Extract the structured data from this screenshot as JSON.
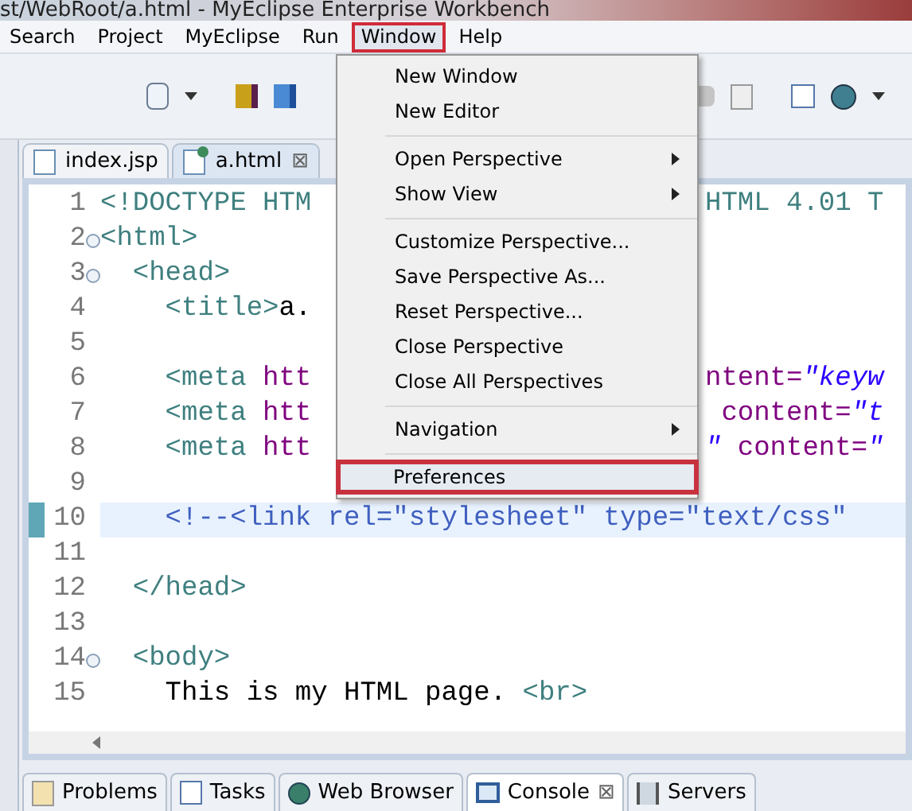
{
  "window": {
    "title": "st/WebRoot/a.html - MyEclipse Enterprise Workbench"
  },
  "menu_bar": [
    {
      "label": "Search",
      "selected": false
    },
    {
      "label": "Project",
      "selected": false
    },
    {
      "label": "MyEclipse",
      "selected": false
    },
    {
      "label": "Run",
      "selected": false
    },
    {
      "label": "Window",
      "selected": true
    },
    {
      "label": "Help",
      "selected": false
    }
  ],
  "editor_tabs": [
    {
      "label": "index.jsp",
      "kind": "jsp",
      "selected": false
    },
    {
      "label": "a.html",
      "kind": "html",
      "selected": true,
      "close": "⊠"
    }
  ],
  "editor": {
    "lines": [
      {
        "number": "1",
        "fold": false,
        "current": false,
        "left": [
          {
            "kind": "tag",
            "text": "<!DOCTYPE HTM"
          }
        ],
        "right": [
          {
            "kind": "tag",
            "text": "HTML 4.01 T"
          }
        ]
      },
      {
        "number": "2",
        "fold": true,
        "current": false,
        "left": [
          {
            "kind": "tag",
            "text": "<html>"
          }
        ]
      },
      {
        "number": "3",
        "fold": true,
        "current": false,
        "left": [
          {
            "kind": "tag",
            "text": "  <head>"
          }
        ]
      },
      {
        "number": "4",
        "fold": false,
        "current": false,
        "left": [
          {
            "kind": "tag",
            "text": "    <title>"
          },
          {
            "kind": "text",
            "text": "a."
          }
        ]
      },
      {
        "number": "5",
        "fold": false,
        "current": false
      },
      {
        "number": "6",
        "fold": false,
        "current": false,
        "left": [
          {
            "kind": "tag",
            "text": "    <meta "
          },
          {
            "kind": "attr",
            "text": "htt"
          }
        ],
        "right": [
          {
            "kind": "attr",
            "text": "ntent="
          },
          {
            "kind": "value",
            "text": "\"keyw"
          }
        ]
      },
      {
        "number": "7",
        "fold": false,
        "current": false,
        "left": [
          {
            "kind": "tag",
            "text": "    <meta "
          },
          {
            "kind": "attr",
            "text": "htt"
          }
        ],
        "right": [
          {
            "kind": "attr",
            "text": " content="
          },
          {
            "kind": "value",
            "text": "\"t"
          }
        ]
      },
      {
        "number": "8",
        "fold": false,
        "current": false,
        "left": [
          {
            "kind": "tag",
            "text": "    <meta "
          },
          {
            "kind": "attr",
            "text": "htt"
          }
        ],
        "right": [
          {
            "kind": "value",
            "text": "\""
          },
          {
            "kind": "attr",
            "text": " content="
          },
          {
            "kind": "value",
            "text": "\""
          }
        ]
      },
      {
        "number": "9",
        "fold": false,
        "current": false
      },
      {
        "number": "10",
        "fold": false,
        "current": true,
        "left": [
          {
            "kind": "comment",
            "text": "    <!--<link rel=\"stylesheet\" type=\"text/css\""
          }
        ]
      },
      {
        "number": "11",
        "fold": false,
        "current": false
      },
      {
        "number": "12",
        "fold": false,
        "current": false,
        "left": [
          {
            "kind": "tag",
            "text": "  </head>"
          }
        ]
      },
      {
        "number": "13",
        "fold": false,
        "current": false
      },
      {
        "number": "14",
        "fold": true,
        "current": false,
        "left": [
          {
            "kind": "tag",
            "text": "  <body>"
          }
        ]
      },
      {
        "number": "15",
        "fold": false,
        "current": false,
        "left": [
          {
            "kind": "text",
            "text": "    This is my HTML page. "
          },
          {
            "kind": "tag",
            "text": "<br>"
          }
        ]
      }
    ]
  },
  "window_menu": [
    {
      "kind": "item",
      "label": "New Window",
      "selected": false
    },
    {
      "kind": "item",
      "label": "New Editor",
      "selected": false
    },
    {
      "kind": "separator"
    },
    {
      "kind": "submenu",
      "label": "Open Perspective",
      "selected": false
    },
    {
      "kind": "submenu",
      "label": "Show View",
      "selected": false
    },
    {
      "kind": "separator"
    },
    {
      "kind": "item",
      "label": "Customize Perspective...",
      "selected": false
    },
    {
      "kind": "item",
      "label": "Save Perspective As...",
      "selected": false
    },
    {
      "kind": "item",
      "label": "Reset Perspective...",
      "selected": false
    },
    {
      "kind": "item",
      "label": "Close Perspective",
      "selected": false
    },
    {
      "kind": "item",
      "label": "Close All Perspectives",
      "selected": false
    },
    {
      "kind": "separator"
    },
    {
      "kind": "submenu",
      "label": "Navigation",
      "selected": false
    },
    {
      "kind": "separator"
    },
    {
      "kind": "item",
      "label": "Preferences",
      "selected": true
    }
  ],
  "bottom_tabs": [
    {
      "label": "Problems",
      "kind": "problems",
      "selected": false
    },
    {
      "label": "Tasks",
      "kind": "tasks",
      "selected": false
    },
    {
      "label": "Web Browser",
      "kind": "browser",
      "selected": false
    },
    {
      "label": "Console",
      "kind": "console",
      "selected": true,
      "close": "⊠"
    },
    {
      "label": "Servers",
      "kind": "servers",
      "selected": false
    }
  ]
}
